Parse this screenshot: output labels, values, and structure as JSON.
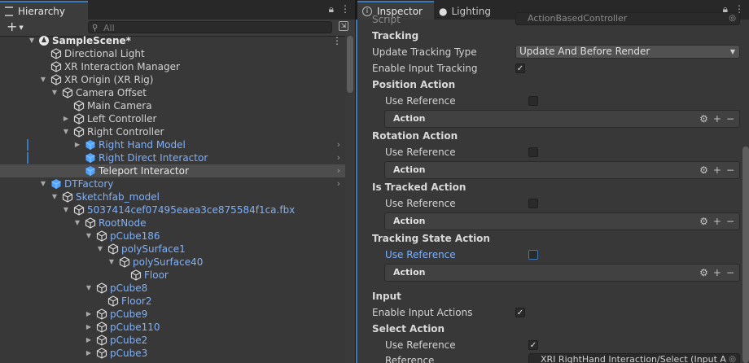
{
  "hierarchy": {
    "tab_label": "Hierarchy",
    "add_label": "+",
    "search_placeholder": "All",
    "scene_name": "SampleScene*",
    "items": [
      {
        "label": "Directional Light"
      },
      {
        "label": "XR Interaction Manager"
      },
      {
        "label": "XR Origin (XR Rig)"
      },
      {
        "label": "Camera Offset"
      },
      {
        "label": "Main Camera"
      },
      {
        "label": "Left Controller"
      },
      {
        "label": "Right Controller"
      },
      {
        "label": "Right Hand Model"
      },
      {
        "label": "Right Direct Interactor"
      },
      {
        "label": "Teleport Interactor"
      },
      {
        "label": "DTFactory"
      },
      {
        "label": "Sketchfab_model"
      },
      {
        "label": "5037414cef07495eaea3ce875584f1ca.fbx"
      },
      {
        "label": "RootNode"
      },
      {
        "label": "pCube186"
      },
      {
        "label": "polySurface1"
      },
      {
        "label": "polySurface40"
      },
      {
        "label": "Floor"
      },
      {
        "label": "pCube8"
      },
      {
        "label": "Floor2"
      },
      {
        "label": "pCube9"
      },
      {
        "label": "pCube110"
      },
      {
        "label": "pCube2"
      },
      {
        "label": "pCube3"
      }
    ]
  },
  "inspector": {
    "tab_label": "Inspector",
    "lighting_tab_label": "Lighting",
    "script_label": "Script",
    "script_value": "ActionBasedController",
    "tracking_header": "Tracking",
    "update_tracking_type_label": "Update Tracking Type",
    "update_tracking_type_value": "Update And Before Render",
    "enable_input_tracking_label": "Enable Input Tracking",
    "position_action_header": "Position Action",
    "rotation_action_header": "Rotation Action",
    "is_tracked_action_header": "Is Tracked Action",
    "tracking_state_action_header": "Tracking State Action",
    "use_reference_label": "Use Reference",
    "action_label": "Action",
    "input_header": "Input",
    "enable_input_actions_label": "Enable Input Actions",
    "select_action_header": "Select Action",
    "reference_label": "Reference",
    "reference_value": "XRI RightHand Interaction/Select (Input A"
  },
  "colors": {
    "accent": "#3a79bb",
    "prefab_text": "#7bb1ff",
    "panel_bg": "#383838",
    "selection": "#4d4d4d"
  }
}
